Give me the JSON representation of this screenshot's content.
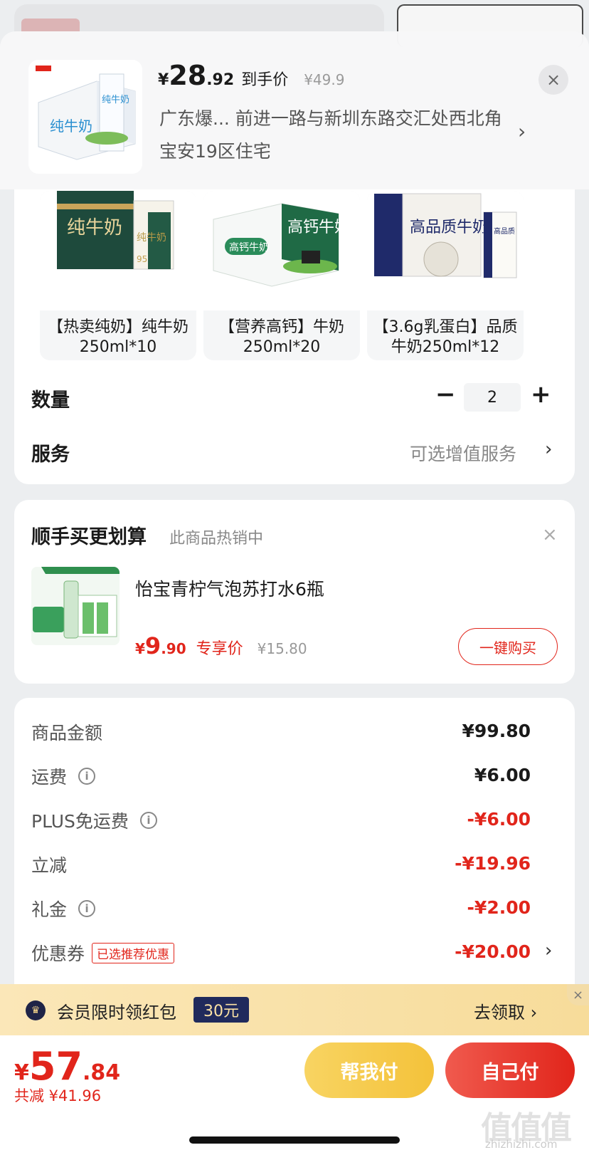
{
  "header": {
    "currency": "¥",
    "price_int": "28",
    "price_dec": ".92",
    "price_label": "到手价",
    "original_price": "¥49.9",
    "address": "广东爆... 前进一路与新圳东路交汇处西北角宝安19区住宅",
    "chevron": "›",
    "close": "×"
  },
  "products": [
    {
      "name": "【热卖纯奶】纯牛奶250ml*10",
      "box_text": "纯牛奶"
    },
    {
      "name": "【营养高钙】牛奶250ml*20",
      "box_text": "高钙牛奶"
    },
    {
      "name": "【3.6g乳蛋白】品质牛奶250ml*12",
      "box_text": "高品质牛奶"
    }
  ],
  "quantity": {
    "label": "数量",
    "minus": "−",
    "value": "2",
    "plus": "+"
  },
  "service": {
    "label": "服务",
    "value": "可选增值服务",
    "chevron": "›"
  },
  "addon": {
    "title": "顺手买更划算",
    "subtitle": "此商品热销中",
    "close": "×",
    "item_name": "怡宝青柠气泡苏打水6瓶",
    "currency": "¥",
    "price_int": "9",
    "price_dec": ".90",
    "price_label": "专享价",
    "original_price": "¥15.80",
    "buy_button": "一键购买"
  },
  "summary": {
    "goods_label": "商品金额",
    "goods_value": "¥99.80",
    "shipping_label": "运费",
    "shipping_value": "¥6.00",
    "plus_label": "PLUS免运费",
    "plus_value": "-¥6.00",
    "discount_label": "立减",
    "discount_value": "-¥19.96",
    "gift_label": "礼金",
    "gift_value": "-¥2.00",
    "coupon_label": "优惠券",
    "coupon_tag": "已选推荐优惠",
    "coupon_value": "-¥20.00",
    "info_icon": "i",
    "chevron": "›"
  },
  "banner": {
    "text": "会员限时领红包",
    "badge": "30元",
    "action": "去领取 ›",
    "close": "×"
  },
  "bottom": {
    "currency": "¥",
    "total_int": "57",
    "total_dec": ".84",
    "saved": "共减 ¥41.96",
    "help_pay": "帮我付",
    "self_pay": "自己付"
  },
  "watermark": {
    "logo": "值值值",
    "url": "zhizhizhi.com"
  },
  "colors": {
    "accent": "#e1251b",
    "banner_bg": "#fbe7b8",
    "badge_bg": "#202a5c",
    "help_btn": "#f4c23a"
  }
}
